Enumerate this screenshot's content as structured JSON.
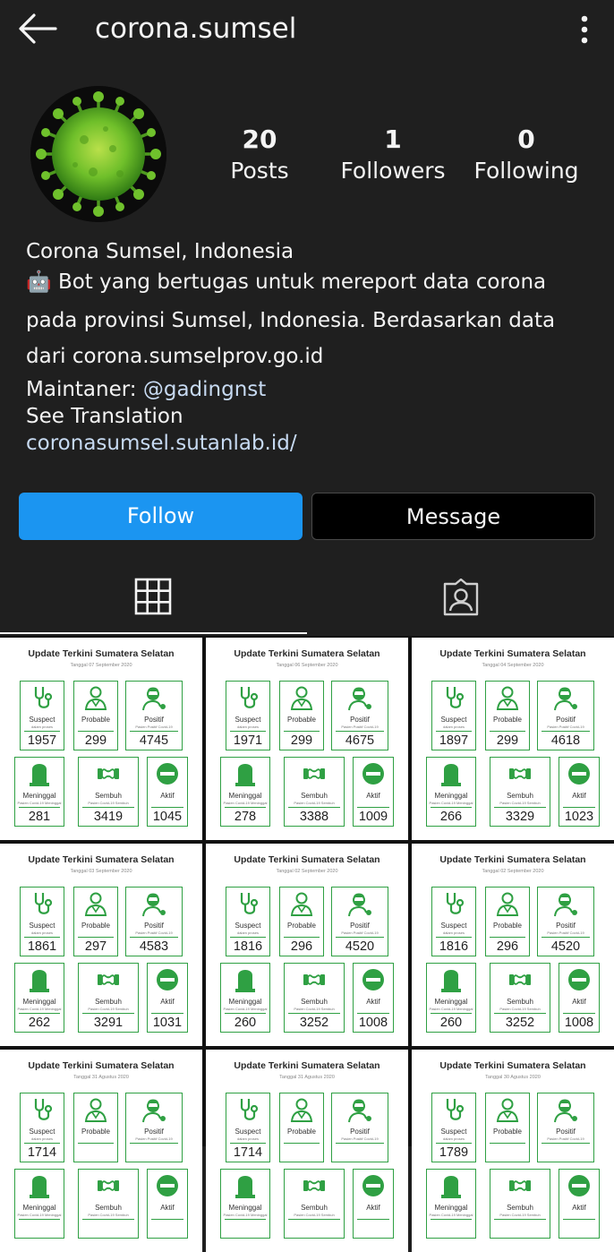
{
  "header": {
    "username": "corona.sumsel"
  },
  "stats": {
    "posts": {
      "value": "20",
      "label": "Posts"
    },
    "followers": {
      "value": "1",
      "label": "Followers"
    },
    "following": {
      "value": "0",
      "label": "Following"
    }
  },
  "bio": {
    "name": "Corona Sumsel, Indonesia",
    "line1": "🤖 Bot yang bertugas untuk mereport data corona",
    "line2": "pada provinsi Sumsel, Indonesia. Berdasarkan data",
    "line3": "dari corona.sumselprov.go.id",
    "maintainer_prefix": "Maintaner: ",
    "maintainer_handle": "@gadingnst",
    "see_translation": "See Translation",
    "website": "coronasumsel.sutanlab.id/"
  },
  "buttons": {
    "follow": "Follow",
    "message": "Message"
  },
  "post_template": {
    "title": "Update Terkini Sumatera Selatan",
    "labels": [
      "Suspect",
      "Probable",
      "Positif",
      "Meninggal",
      "Sembuh",
      "Aktif"
    ],
    "sublabels": [
      "dalam proses",
      "",
      "Pasien Positif Covid-19",
      "Pasien Covid-19 Meninggal",
      "Pasien Covid-19 Sembuh",
      ""
    ]
  },
  "posts": [
    {
      "date": "Tanggal 07 September 2020",
      "values": [
        "1957",
        "299",
        "4745",
        "281",
        "3419",
        "1045"
      ]
    },
    {
      "date": "Tanggal 06 September 2020",
      "values": [
        "1971",
        "299",
        "4675",
        "278",
        "3388",
        "1009"
      ]
    },
    {
      "date": "Tanggal 04 September 2020",
      "values": [
        "1897",
        "299",
        "4618",
        "266",
        "3329",
        "1023"
      ]
    },
    {
      "date": "Tanggal 03 September 2020",
      "values": [
        "1861",
        "297",
        "4583",
        "262",
        "3291",
        "1031"
      ]
    },
    {
      "date": "Tanggal 02 September 2020",
      "values": [
        "1816",
        "296",
        "4520",
        "260",
        "3252",
        "1008"
      ]
    },
    {
      "date": "Tanggal 02 September 2020",
      "values": [
        "1816",
        "296",
        "4520",
        "260",
        "3252",
        "1008"
      ]
    },
    {
      "date": "Tanggal 31 Agustus 2020",
      "values": [
        "1714",
        "",
        "",
        "",
        "",
        ""
      ]
    },
    {
      "date": "Tanggal 31 Agustus 2020",
      "values": [
        "1714",
        "",
        "",
        "",
        "",
        ""
      ]
    },
    {
      "date": "Tanggal 30 Agustus 2020",
      "values": [
        "1789",
        "",
        "",
        "",
        "",
        ""
      ]
    }
  ],
  "colors": {
    "follow_button": "#1b95f1",
    "card_green": "#2fa043",
    "background": "#1f1f1f"
  }
}
